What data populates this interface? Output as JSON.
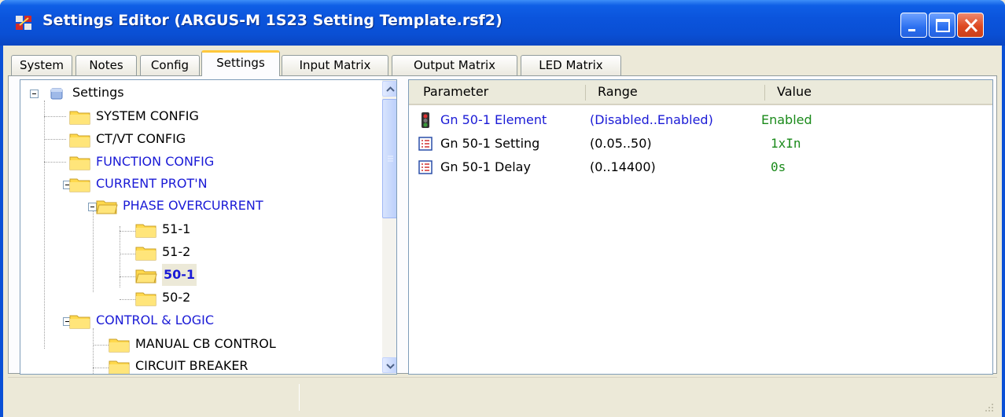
{
  "window": {
    "title": "Settings Editor (ARGUS-M 1S23 Setting Template.rsf2)",
    "accent": "#0a50d6"
  },
  "tabs": [
    {
      "label": "System"
    },
    {
      "label": "Notes"
    },
    {
      "label": "Config"
    },
    {
      "label": "Settings",
      "active": true
    },
    {
      "label": "Input Matrix"
    },
    {
      "label": "Output Matrix"
    },
    {
      "label": "LED Matrix"
    }
  ],
  "tree": {
    "root": "Settings",
    "items": [
      {
        "label": "SYSTEM CONFIG"
      },
      {
        "label": "CT/VT CONFIG"
      },
      {
        "label": "FUNCTION CONFIG"
      },
      {
        "label": "CURRENT PROT'N"
      },
      {
        "label": "PHASE OVERCURRENT"
      },
      {
        "label": "51-1"
      },
      {
        "label": "51-2"
      },
      {
        "label": "50-1",
        "selected": true
      },
      {
        "label": "50-2"
      },
      {
        "label": "CONTROL & LOGIC"
      },
      {
        "label": "MANUAL CB CONTROL"
      },
      {
        "label": "CIRCUIT BREAKER"
      }
    ]
  },
  "list": {
    "columns": [
      "Parameter",
      "Range",
      "Value"
    ],
    "rows": [
      {
        "icon": "traffic-light-icon",
        "parameter": "Gn 50-1 Element",
        "range": "(Disabled..Enabled)",
        "value": "Enabled"
      },
      {
        "icon": "list-setting-icon",
        "parameter": "Gn 50-1 Setting",
        "range": "(0.05..50)",
        "value": "1xIn"
      },
      {
        "icon": "list-setting-icon",
        "parameter": "Gn 50-1 Delay",
        "range": "(0..14400)",
        "value": "0s"
      }
    ]
  },
  "colors": {
    "link_blue": "#1a1ad6",
    "value_green": "#1a8a1a",
    "tab_highlight": "#ffc83c"
  }
}
